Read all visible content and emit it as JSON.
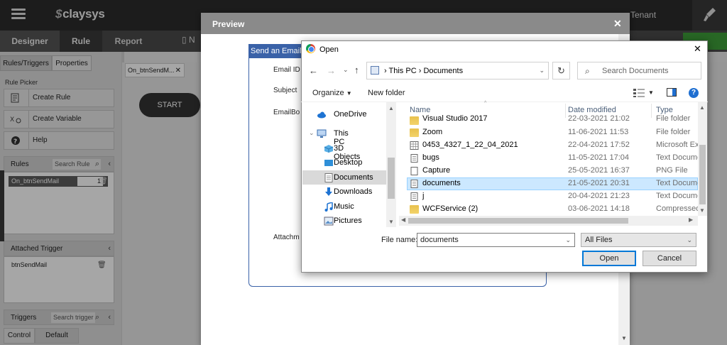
{
  "app": {
    "brand": "claysys",
    "tenant": "Tenant"
  },
  "tabs": {
    "designer": "Designer",
    "rule": "Rule",
    "report": "Report",
    "partial": "N"
  },
  "left_panel": {
    "tabs": [
      "Rules/Triggers",
      "Properties"
    ],
    "rule_picker_label": "Rule Picker",
    "picker_items": [
      "Create Rule",
      "Create Variable",
      "Help"
    ],
    "rules_header": "Rules",
    "rules_search_placeholder": "Search Rule",
    "rule_items": [
      {
        "name": "On_btnSendMail",
        "count": "1"
      }
    ],
    "attached_trigger_header": "Attached Trigger",
    "attached_trigger_items": [
      "btnSendMail"
    ],
    "triggers_header": "Triggers",
    "triggers_search_placeholder": "Search trigger",
    "bottom_tabs": [
      "Control",
      "Default"
    ]
  },
  "canvas": {
    "doc_tab": "On_btnSendM...",
    "start_node": "START"
  },
  "preview": {
    "title": "Preview",
    "form_header": "Send an Email",
    "field_labels": [
      "Email ID",
      "Subject",
      "EmailBo",
      "Attachm"
    ]
  },
  "open_dialog": {
    "title": "Open",
    "breadcrumb": [
      "This PC",
      "Documents"
    ],
    "search_placeholder": "Search Documents",
    "toolbar": {
      "organize": "Organize",
      "new_folder": "New folder"
    },
    "nav_items": [
      {
        "label": "OneDrive",
        "icon": "cloud-icon"
      },
      {
        "label": "This PC",
        "icon": "pc-icon"
      },
      {
        "label": "3D Objects",
        "icon": "cube-icon"
      },
      {
        "label": "Desktop",
        "icon": "desktop-icon"
      },
      {
        "label": "Documents",
        "icon": "document-icon"
      },
      {
        "label": "Downloads",
        "icon": "download-icon"
      },
      {
        "label": "Music",
        "icon": "music-icon"
      },
      {
        "label": "Pictures",
        "icon": "picture-icon"
      }
    ],
    "columns": [
      "Name",
      "Date modified",
      "Type"
    ],
    "files": [
      {
        "name": "Visual Studio 2017",
        "date": "22-03-2021 21:02",
        "type": "File folder",
        "icon": "folder-icon"
      },
      {
        "name": "Zoom",
        "date": "11-06-2021 11:53",
        "type": "File folder",
        "icon": "folder-icon"
      },
      {
        "name": "0453_4327_1_22_04_2021",
        "date": "22-04-2021 17:52",
        "type": "Microsoft Ex",
        "icon": "spreadsheet-icon"
      },
      {
        "name": "bugs",
        "date": "11-05-2021 17:04",
        "type": "Text Docume",
        "icon": "text-file-icon"
      },
      {
        "name": "Capture",
        "date": "25-05-2021 16:37",
        "type": "PNG File",
        "icon": "image-file-icon"
      },
      {
        "name": "documents",
        "date": "21-05-2021 20:31",
        "type": "Text Docume",
        "icon": "text-file-icon"
      },
      {
        "name": "j",
        "date": "20-04-2021 21:23",
        "type": "Text Docume",
        "icon": "text-file-icon"
      },
      {
        "name": "WCFService (2)",
        "date": "03-06-2021 14:18",
        "type": "Compressed",
        "icon": "zip-folder-icon"
      }
    ],
    "selected_index": 5,
    "file_name_label": "File name:",
    "file_name_value": "documents",
    "filter_value": "All Files",
    "open_button": "Open",
    "cancel_button": "Cancel"
  },
  "colors": {
    "accent_blue": "#3a62a8",
    "green_button": "#3e9e3a",
    "topbar": "#2b2b2b",
    "selection": "#cce8ff"
  }
}
